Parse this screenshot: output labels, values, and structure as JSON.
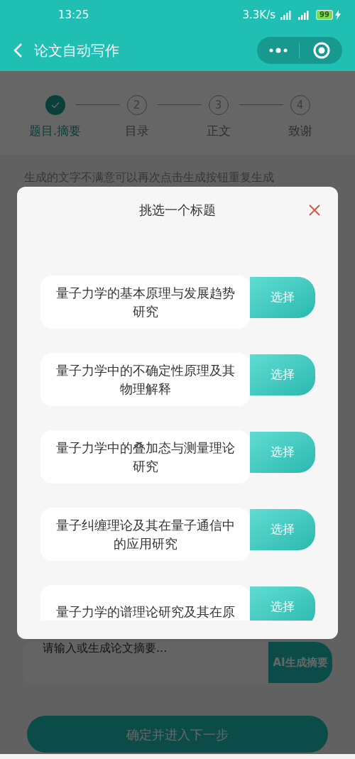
{
  "status_bar": {
    "time": "13:25",
    "speed": "3.3K/s",
    "battery": "99"
  },
  "header": {
    "title": "论文自动写作"
  },
  "steps": [
    {
      "label": "题目.摘要",
      "done": true
    },
    {
      "number": "2",
      "label": "目录",
      "done": false
    },
    {
      "number": "3",
      "label": "正文",
      "done": false
    },
    {
      "number": "4",
      "label": "致谢",
      "done": false
    }
  ],
  "hint": "生成的文字不满意可以再次点击生成按钮重复生成",
  "abstract": {
    "placeholder": "请输入或生成论文摘要...",
    "button": "AI生成摘要"
  },
  "next_button": "确定并进入下一步",
  "dialog": {
    "title": "挑选一个标题",
    "options": [
      {
        "title": "量子力学的基本原理与发展趋势研究",
        "button": "选择"
      },
      {
        "title": "量子力学中的不确定性原理及其物理解释",
        "button": "选择"
      },
      {
        "title": "量子力学中的叠加态与测量理论研究",
        "button": "选择"
      },
      {
        "title": "量子纠缠理论及其在量子通信中的应用研究",
        "button": "选择"
      },
      {
        "title": "量子力学的谱理论研究及其在原",
        "button": "选择"
      }
    ]
  }
}
